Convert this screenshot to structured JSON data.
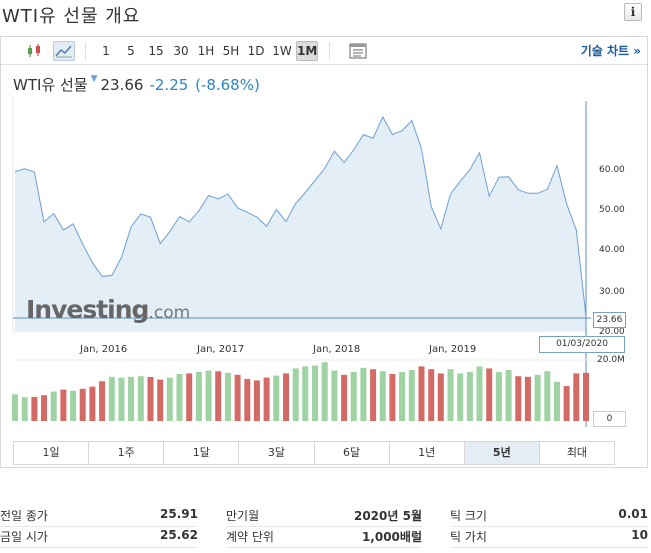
{
  "page": {
    "title": "WTI유 선물 개요",
    "info_icon": "i"
  },
  "toolbar": {
    "intervals": [
      "1",
      "5",
      "15",
      "30",
      "1H",
      "5H",
      "1D",
      "1W",
      "1M"
    ],
    "active_interval": "1M",
    "tech_chart_link": "기술 차트 »",
    "icons": [
      "candlestick-icon",
      "area-chart-icon",
      "table-view-icon"
    ]
  },
  "quote": {
    "name": "WTI유 선물",
    "price": "23.66",
    "change": "-2.25",
    "change_pct": "(-8.68%)"
  },
  "axis": {
    "y_labels": [
      "60.00",
      "50.00",
      "40.00",
      "30.00",
      "20.00"
    ],
    "x_labels": [
      "Jan, 2016",
      "Jan, 2017",
      "Jan, 2018",
      "Jan, 2019"
    ],
    "current_price": "23.66",
    "current_date": "01/03/2020",
    "volume_max": "20.0M",
    "volume_zero": "0"
  },
  "watermark": {
    "brand": "Investing",
    "suffix": ".com"
  },
  "periods": {
    "items": [
      "1일",
      "1주",
      "1달",
      "3달",
      "6달",
      "1년",
      "5년",
      "최대"
    ],
    "active": "5년"
  },
  "stats": {
    "col1": [
      {
        "label": "전일 종가",
        "value": "25.91"
      },
      {
        "label": "금일 시가",
        "value": "25.62"
      }
    ],
    "col2": [
      {
        "label": "만기월",
        "value": "2020년 5월"
      },
      {
        "label": "계약 단위",
        "value": "1,000배럴"
      }
    ],
    "col3": [
      {
        "label": "틱 크기",
        "value": "0.01"
      },
      {
        "label": "틱 가치",
        "value": "10"
      }
    ]
  },
  "colors": {
    "line": "#6f9fd0",
    "area": "#e3eef7",
    "vol_up": "#9fd3a3",
    "vol_down": "#d46a66",
    "price_line": "#5b8fc5"
  },
  "chart_data": {
    "type": "area",
    "x_start": "2015-04",
    "x_end": "2020-03",
    "ylim": [
      20,
      70
    ],
    "prices": [
      59.6,
      60.3,
      59.5,
      47.1,
      49.2,
      45.1,
      46.6,
      41.6,
      37.0,
      33.6,
      33.8,
      38.3,
      45.9,
      49.1,
      48.3,
      41.7,
      44.7,
      48.4,
      47.1,
      49.9,
      53.7,
      52.8,
      54.0,
      50.6,
      49.5,
      48.3,
      46.0,
      50.2,
      47.2,
      51.7,
      54.4,
      57.4,
      60.4,
      64.7,
      61.9,
      65.0,
      68.8,
      67.9,
      73.2,
      68.8,
      69.8,
      72.3,
      65.3,
      50.9,
      45.4,
      54.0,
      57.2,
      60.1,
      64.3,
      53.5,
      58.2,
      58.3,
      55.1,
      54.2,
      54.2,
      55.2,
      61.1,
      51.6,
      45.1,
      23.66
    ],
    "volumes": [
      9.5,
      8.5,
      8.6,
      9.2,
      10.5,
      11.2,
      10.8,
      11.5,
      12.3,
      14.2,
      15.8,
      15.5,
      15.8,
      16.0,
      15.7,
      14.8,
      15.5,
      16.8,
      17.0,
      17.5,
      18.0,
      17.8,
      17.2,
      16.5,
      15.0,
      14.5,
      15.5,
      16.2,
      17.0,
      18.8,
      19.5,
      19.8,
      21.0,
      18.0,
      16.5,
      17.5,
      19.0,
      18.5,
      17.8,
      16.8,
      17.5,
      18.2,
      19.5,
      18.5,
      17.0,
      18.5,
      17.0,
      17.5,
      19.5,
      18.8,
      17.5,
      18.2,
      16.0,
      15.8,
      16.5,
      17.8,
      14.0,
      12.5,
      17.0,
      17.2
    ],
    "volume_max": 20
  }
}
